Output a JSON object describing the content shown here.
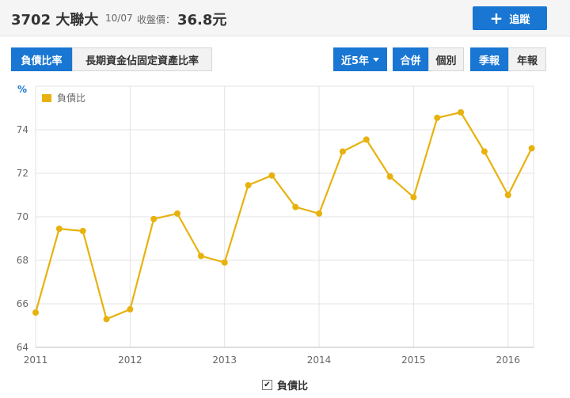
{
  "header": {
    "stock_title": "3702 大聯大",
    "date": "10/07",
    "price_label": "收盤價：",
    "price": "36.8元",
    "track_label": "追蹤"
  },
  "tabs": [
    {
      "label": "負債比率",
      "active": true
    },
    {
      "label": "長期資金佔固定資產比率",
      "active": false
    }
  ],
  "controls": {
    "range": "近5年",
    "consolidated": "合併",
    "individual": "個別",
    "quarterly": "季報",
    "annual": "年報"
  },
  "icons": {
    "track": "plus-icon",
    "range_dropdown": "caret-down-icon",
    "legend_checkbox": "checkbox-checked-icon"
  },
  "footer_legend": {
    "label": "負債比",
    "checked": true
  },
  "chart_data": {
    "type": "line",
    "ylabel": "%",
    "legend_position": "top-left",
    "grid": true,
    "ylim": [
      64,
      76
    ],
    "yticks": [
      64,
      66,
      68,
      70,
      72,
      74
    ],
    "xlim": [
      2011.0,
      2016.27
    ],
    "xticks": [
      "2011",
      "2012",
      "2013",
      "2014",
      "2015",
      "2016"
    ],
    "series": [
      {
        "name": "負債比",
        "color": "#e8b20e",
        "points": [
          {
            "x": 2011.0,
            "y": 65.6
          },
          {
            "x": 2011.25,
            "y": 69.45
          },
          {
            "x": 2011.5,
            "y": 69.35
          },
          {
            "x": 2011.75,
            "y": 65.3
          },
          {
            "x": 2012.0,
            "y": 65.75
          },
          {
            "x": 2012.25,
            "y": 69.9
          },
          {
            "x": 2012.5,
            "y": 70.15
          },
          {
            "x": 2012.75,
            "y": 68.2
          },
          {
            "x": 2013.0,
            "y": 67.9
          },
          {
            "x": 2013.25,
            "y": 71.45
          },
          {
            "x": 2013.5,
            "y": 71.9
          },
          {
            "x": 2013.75,
            "y": 70.45
          },
          {
            "x": 2014.0,
            "y": 70.15
          },
          {
            "x": 2014.25,
            "y": 73.0
          },
          {
            "x": 2014.5,
            "y": 73.55
          },
          {
            "x": 2014.75,
            "y": 71.85
          },
          {
            "x": 2015.0,
            "y": 70.9
          },
          {
            "x": 2015.25,
            "y": 74.55
          },
          {
            "x": 2015.5,
            "y": 74.8
          },
          {
            "x": 2015.75,
            "y": 73.0
          },
          {
            "x": 2016.0,
            "y": 71.0
          },
          {
            "x": 2016.25,
            "y": 73.15
          }
        ]
      }
    ]
  }
}
